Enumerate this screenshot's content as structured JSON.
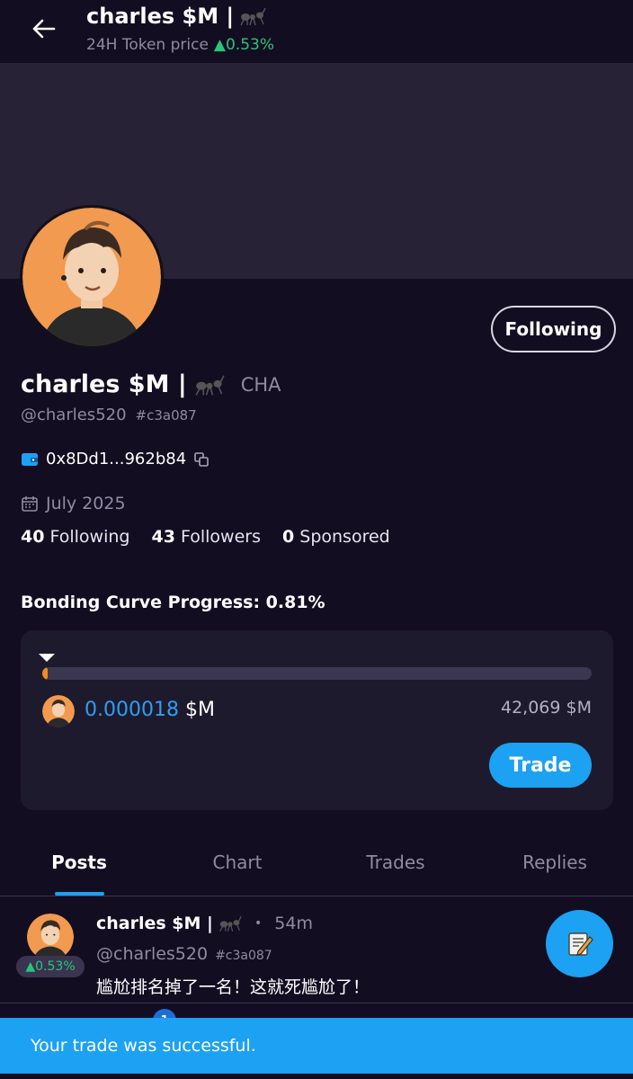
{
  "header": {
    "title": "charles $M |",
    "subtitle_label": "24H Token price",
    "subtitle_change": "▲0.53%"
  },
  "profile": {
    "follow_button": "Following",
    "name": "charles $M |",
    "ticker": "CHA",
    "handle": "@charles520",
    "hash": "#c3a087",
    "wallet": "0x8Dd1...962b84",
    "joined": "July 2025",
    "stats": {
      "following_count": "40",
      "following_label": "Following",
      "followers_count": "43",
      "followers_label": "Followers",
      "sponsored_count": "0",
      "sponsored_label": "Sponsored"
    }
  },
  "bonding_curve": {
    "title": "Bonding Curve Progress: 0.81%",
    "progress_percent": 0.81,
    "price_value": "0.000018",
    "price_unit": "$M",
    "market_cap": "42,069 $M",
    "trade_button": "Trade"
  },
  "tabs": [
    {
      "label": "Posts",
      "active": true
    },
    {
      "label": "Chart",
      "active": false
    },
    {
      "label": "Trades",
      "active": false
    },
    {
      "label": "Replies",
      "active": false
    }
  ],
  "post": {
    "badge": "▲0.53%",
    "name": "charles $M |",
    "time": "54m",
    "handle": "@charles520",
    "hash": "#c3a087",
    "text": "尴尬排名掉了一名！这就死尴尬了！"
  },
  "notification_count": "1",
  "toast": "Your trade was successful.",
  "colors": {
    "background": "#130d22",
    "banner": "#272236",
    "accent": "#1da1f2",
    "positive": "#27c77a",
    "progress": "#f28a1f"
  },
  "icons": [
    "back-arrow-icon",
    "ant-icon",
    "wallet-icon",
    "copy-icon",
    "calendar-icon",
    "edit-note-icon"
  ]
}
